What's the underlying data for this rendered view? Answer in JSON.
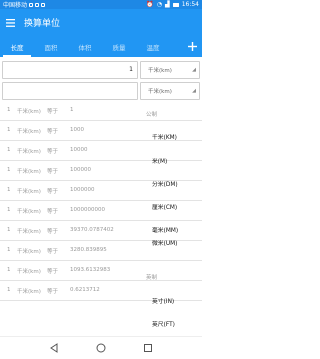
{
  "status_bar": {
    "carrier": "中国移动",
    "time": "16:54"
  },
  "app_bar": {
    "title": "换算单位"
  },
  "tabs": [
    {
      "label": "长度",
      "active": true
    },
    {
      "label": "面积",
      "active": false
    },
    {
      "label": "体积",
      "active": false
    },
    {
      "label": "质量",
      "active": false
    },
    {
      "label": "温度",
      "active": false
    }
  ],
  "inputs": [
    {
      "value": "1",
      "unit": "千米(km)"
    },
    {
      "value": "",
      "unit": "千米(km)"
    }
  ],
  "results": [
    {
      "amount": "1",
      "unit": "千米(km)",
      "eq": "等于",
      "value": "1"
    },
    {
      "amount": "1",
      "unit": "千米(km)",
      "eq": "等于",
      "value": "1000"
    },
    {
      "amount": "1",
      "unit": "千米(km)",
      "eq": "等于",
      "value": "10000"
    },
    {
      "amount": "1",
      "unit": "千米(km)",
      "eq": "等于",
      "value": "100000"
    },
    {
      "amount": "1",
      "unit": "千米(km)",
      "eq": "等于",
      "value": "1000000"
    },
    {
      "amount": "1",
      "unit": "千米(km)",
      "eq": "等于",
      "value": "1000000000"
    },
    {
      "amount": "1",
      "unit": "千米(km)",
      "eq": "等于",
      "value": "39370.0787402"
    },
    {
      "amount": "1",
      "unit": "千米(km)",
      "eq": "等于",
      "value": "3280.839895"
    },
    {
      "amount": "1",
      "unit": "千米(km)",
      "eq": "等于",
      "value": "1093.6132983"
    },
    {
      "amount": "1",
      "unit": "千米(km)",
      "eq": "等于",
      "value": "0.6213712"
    }
  ],
  "categories": {
    "metric": "公制",
    "imperial": "英制"
  },
  "unit_list": [
    "千米(KM)",
    "米(M)",
    "分米(DM)",
    "厘米(CM)",
    "毫米(MM)",
    "微米(UM)",
    "英寸(IN)",
    "英尺(FT)"
  ],
  "colors": {
    "primary": "#2196f3",
    "status_bar": "#1e88e5"
  }
}
